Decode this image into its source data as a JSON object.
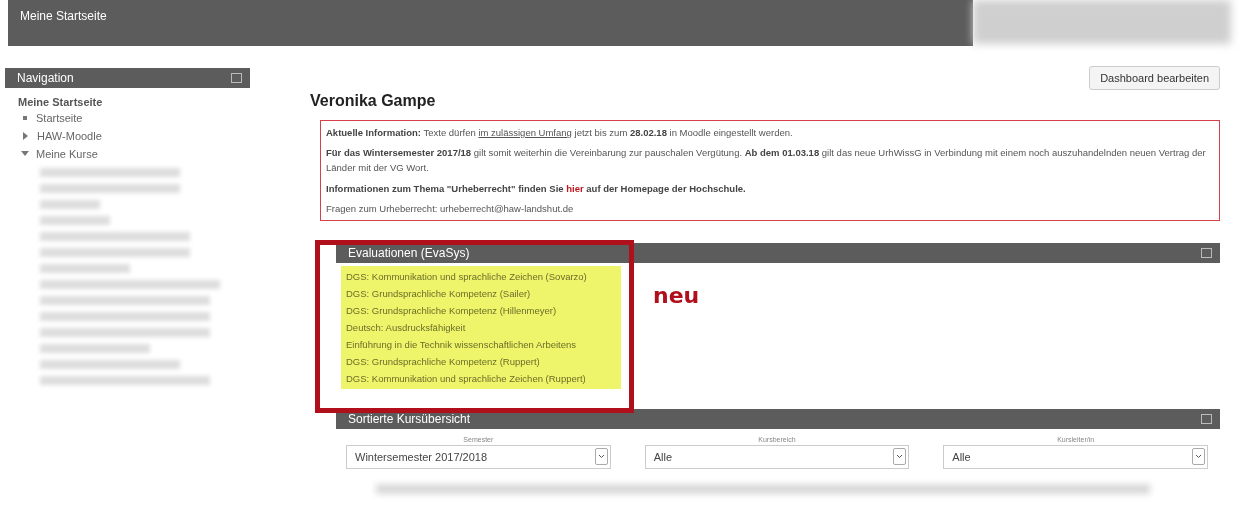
{
  "header": {
    "title": "Meine Startseite"
  },
  "navigation": {
    "title": "Navigation",
    "root": "Meine Startseite",
    "items": [
      {
        "label": "Startseite",
        "kind": "leaf"
      },
      {
        "label": "HAW-Moodle",
        "kind": "collapsed"
      },
      {
        "label": "Meine Kurse",
        "kind": "expanded"
      }
    ]
  },
  "dashboard_button": "Dashboard bearbeiten",
  "page_title": "Veronika Gampe",
  "notice": {
    "paragraphs": [
      {
        "text": "**Aktuelle Information:** Texte dürfen ",
        "link": "im zulässigen Umfang",
        "kind": "underline",
        "rest": " jetzt bis zum **28.02.18** in Moodle eingestellt werden."
      },
      {
        "text": "**Für das Wintersemester 2017/18** gilt somit weiterhin die Vereinbarung zur pauschalen Vergütung. **Ab dem 01.03.18** gilt das neue UrhWissG in Verbindung mit einem noch auszuhandelnden neuen Vertrag der Länder mit der VG Wort."
      },
      {
        "text": "**Informationen zum Thema \"Urheberrecht\" finden Sie** ",
        "link": "hier",
        "kind": "highlight",
        "rest": " **auf der Homepage der Hochschule.**"
      },
      {
        "text": "Fragen zum Urheberrecht: urheberrecht@haw-landshut.de"
      }
    ]
  },
  "evaluations": {
    "title": "Evaluationen (EvaSys)",
    "items": [
      "DGS: Kommunikation und sprachliche Zeichen (Sovarzo)",
      "DGS: Grundsprachliche Kompetenz (Sailer)",
      "DGS: Grundsprachliche Kompetenz (Hillenmeyer)",
      "Deutsch: Ausdrucksfähigkeit",
      "Einführung in die Technik wissenschaftlichen Arbeitens",
      "DGS: Grundsprachliche Kompetenz (Ruppert)",
      "DGS: Kommunikation und sprachliche Zeichen (Ruppert)"
    ],
    "annotation": "neu"
  },
  "course_overview": {
    "title": "Sortierte Kursübersicht",
    "filters": [
      {
        "label": "Semester",
        "value": "Wintersemester 2017/2018"
      },
      {
        "label": "Kursbereich",
        "value": "Alle"
      },
      {
        "label": "Kursleiter/in",
        "value": "Alle"
      }
    ]
  }
}
